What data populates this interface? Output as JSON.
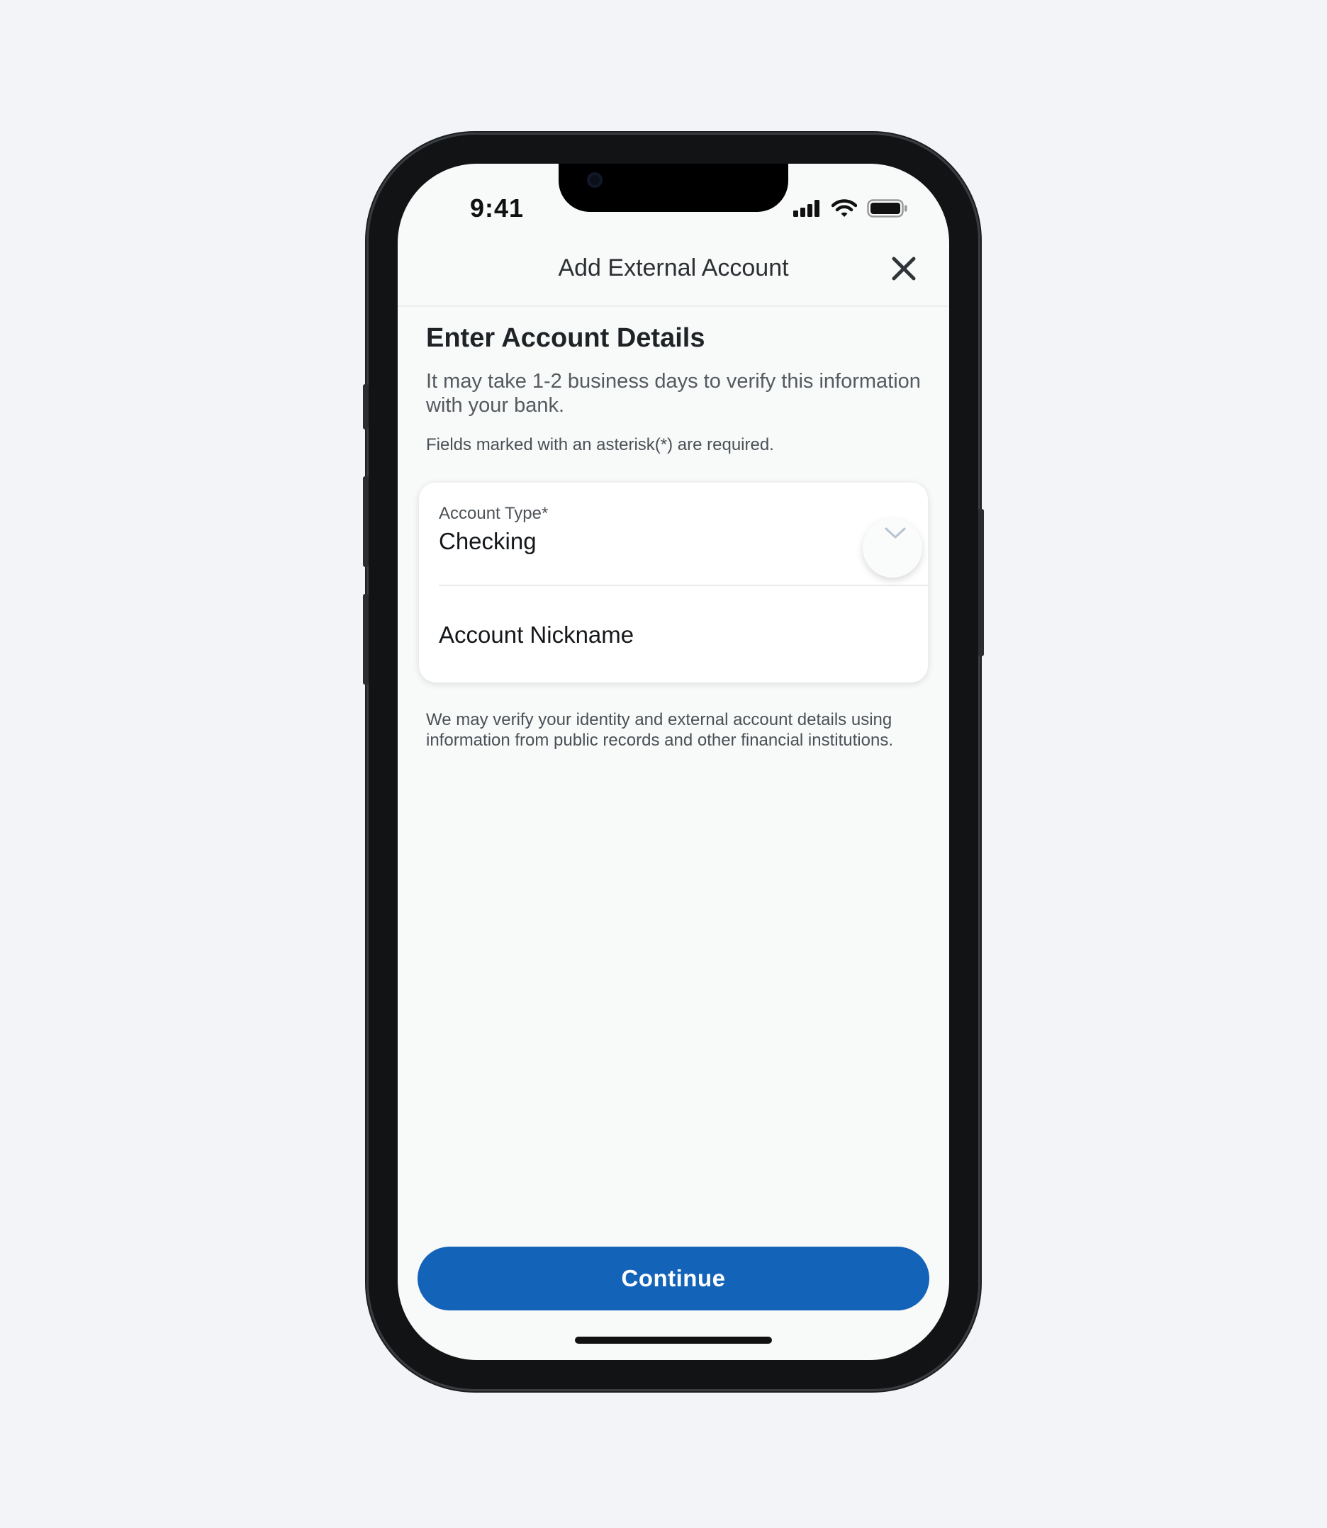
{
  "status_bar": {
    "time": "9:41",
    "icons": [
      "signal-icon",
      "wifi-icon",
      "battery-icon"
    ]
  },
  "nav": {
    "title": "Add External Account",
    "close_icon": "close-icon"
  },
  "content": {
    "heading": "Enter Account Details",
    "subtext": "It may take 1-2 business days to verify this information with your bank.",
    "required_note": "Fields marked with an asterisk(*) are required."
  },
  "form": {
    "account_type_label": "Account Type*",
    "account_type_value": "Checking",
    "dropdown_icon": "chevron-down-icon",
    "nickname_placeholder": "Account Nickname"
  },
  "disclaimer": "We may verify your identity and external account details using information from public records and other financial institutions.",
  "continue_label": "Continue",
  "colors": {
    "primary": "#1363b9",
    "background": "#f2f4f7",
    "screen": "#f8faf9"
  }
}
